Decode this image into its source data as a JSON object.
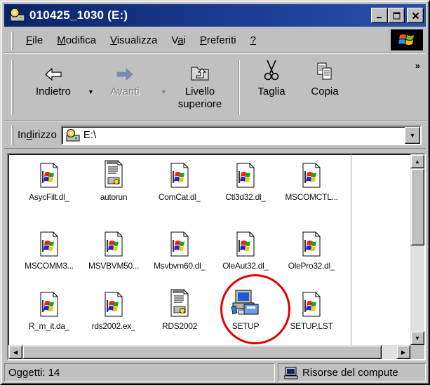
{
  "window": {
    "title": "010425_1030 (E:)",
    "controls": {
      "minimize": "_",
      "maximize": "□",
      "close": "×"
    }
  },
  "menu": {
    "items": [
      {
        "pre": "",
        "ul": "F",
        "post": "ile"
      },
      {
        "pre": "",
        "ul": "M",
        "post": "odifica"
      },
      {
        "pre": "",
        "ul": "V",
        "post": "isualizza"
      },
      {
        "pre": "V",
        "ul": "a",
        "post": "i"
      },
      {
        "pre": "",
        "ul": "P",
        "post": "referiti"
      },
      {
        "pre": "",
        "ul": "?",
        "post": ""
      }
    ]
  },
  "toolbar": {
    "back": "Indietro",
    "forward": "Avanti",
    "up_line1": "Livello",
    "up_line2": "superiore",
    "cut": "Taglia",
    "copy": "Copia",
    "more": "»"
  },
  "address": {
    "label_pre": "In",
    "label_ul": "d",
    "label_post": "irizzo",
    "value": "E:\\"
  },
  "files": [
    {
      "name": "AsycFilt.dl_",
      "icon": "compressed-file-icon"
    },
    {
      "name": "autorun",
      "icon": "setup-info-file-icon"
    },
    {
      "name": "ComCat.dl_",
      "icon": "compressed-file-icon"
    },
    {
      "name": "Ctl3d32.dl_",
      "icon": "compressed-file-icon"
    },
    {
      "name": "MSCOMCTL...",
      "icon": "compressed-file-icon"
    },
    {
      "name": "MSCOMM3...",
      "icon": "compressed-file-icon"
    },
    {
      "name": "MSVBVM50...",
      "icon": "compressed-file-icon"
    },
    {
      "name": "Msvbvm60.dl_",
      "icon": "compressed-file-icon"
    },
    {
      "name": "OleAut32.dl_",
      "icon": "compressed-file-icon"
    },
    {
      "name": "OlePro32.dl_",
      "icon": "compressed-file-icon"
    },
    {
      "name": "R_m_it.da_",
      "icon": "compressed-file-icon"
    },
    {
      "name": "rds2002.ex_",
      "icon": "compressed-file-icon"
    },
    {
      "name": "RDS2002",
      "icon": "setup-info-file-icon"
    },
    {
      "name": "SETUP",
      "icon": "setup-program-icon"
    },
    {
      "name": "SETUP.LST",
      "icon": "compressed-file-icon"
    }
  ],
  "status": {
    "objects": "Oggetti: 14",
    "zone": "Risorse del compute"
  },
  "colors": {
    "title_bar": "#0a246a",
    "highlight_circle": "#e00000"
  }
}
